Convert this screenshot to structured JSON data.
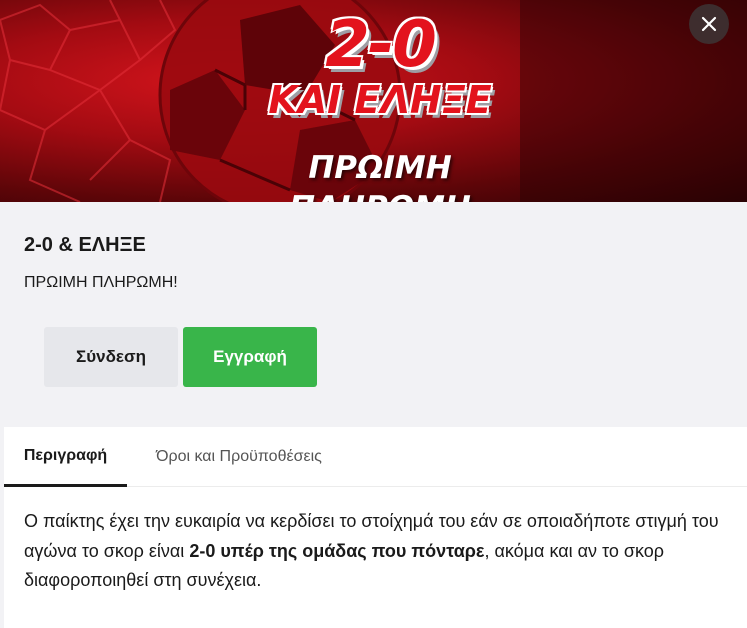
{
  "banner": {
    "score": "2-0",
    "headline": "ΚΑΙ ΕΛΗΞΕ",
    "tagline": "ΠΡΩΙΜΗ ΠΛΗΡΩΜΗ",
    "close_icon": "close-icon",
    "ball_icon": "football-icon"
  },
  "offer": {
    "title": "2-0 & ΕΛΗΞΕ",
    "subtitle": "ΠΡΩΙΜΗ ΠΛΗΡΩΜΗ!"
  },
  "actions": {
    "login_label": "Σύνδεση",
    "register_label": "Εγγραφή"
  },
  "tabs": [
    {
      "label": "Περιγραφή",
      "active": true
    },
    {
      "label": "Όροι και Προϋποθέσεις",
      "active": false
    }
  ],
  "description": {
    "part1": "Ο παίκτης έχει την ευκαιρία να κερδίσει το στοίχημά του εάν σε οποιαδήποτε στιγμή του αγώνα το σκορ είναι ",
    "bold": "2-0 υπέρ της ομάδας που πόνταρε",
    "part2": ", ακόμα και αν το σκορ διαφοροποιηθεί στη συνέχεια."
  },
  "colors": {
    "brand_red": "#e3131d",
    "register_green": "#39b54a",
    "login_gray": "#e6e7eb",
    "background": "#f2f2f5"
  }
}
